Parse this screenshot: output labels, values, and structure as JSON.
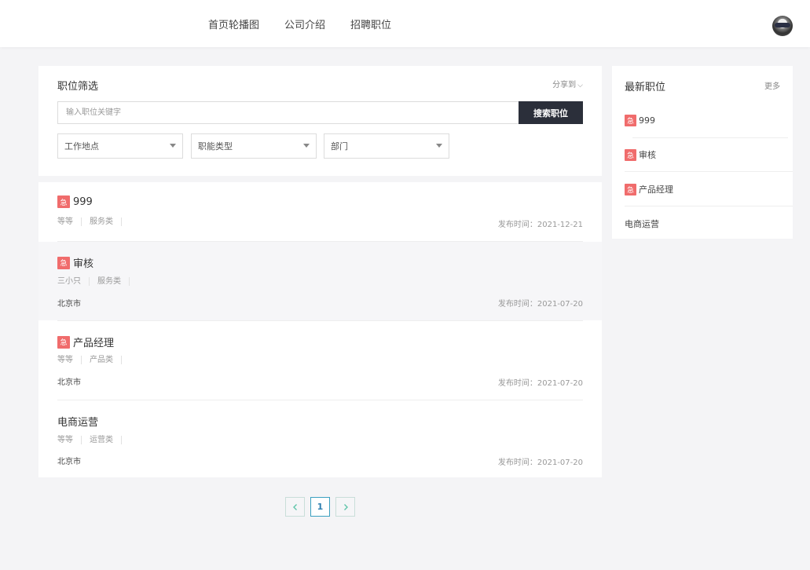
{
  "nav": {
    "items": [
      "首页轮播图",
      "公司介绍",
      "招聘职位"
    ]
  },
  "filter": {
    "title": "职位筛选",
    "share_label": "分享到",
    "search_placeholder": "输入职位关键字",
    "search_button": "搜索职位",
    "selects": [
      "工作地点",
      "职能类型",
      "部门"
    ]
  },
  "jobs": [
    {
      "urgent_badge": "急",
      "name": "999",
      "tags": [
        "等等",
        "服务类"
      ],
      "city": "",
      "date": "发布时间：2021-12-21"
    },
    {
      "urgent_badge": "急",
      "name": "审核",
      "tags": [
        "三小只",
        "服务类"
      ],
      "city": "北京市",
      "date": "发布时间：2021-07-20"
    },
    {
      "urgent_badge": "急",
      "name": "产品经理",
      "tags": [
        "等等",
        "产品类"
      ],
      "city": "北京市",
      "date": "发布时间：2021-07-20"
    },
    {
      "urgent_badge": "",
      "name": "电商运营",
      "tags": [
        "等等",
        "运营类"
      ],
      "city": "北京市",
      "date": "发布时间：2021-07-20"
    }
  ],
  "pagination": {
    "current": "1"
  },
  "latest": {
    "title": "最新职位",
    "more": "更多",
    "items": [
      {
        "urgent_badge": "急",
        "name": "999"
      },
      {
        "urgent_badge": "急",
        "name": "审核"
      },
      {
        "urgent_badge": "急",
        "name": "产品经理"
      },
      {
        "urgent_badge": "",
        "name": "电商运营"
      }
    ]
  },
  "colors": {
    "urgent": "#f06c6c",
    "search_button": "#2b2f3a",
    "pager_accent": "#5fc5a9"
  }
}
